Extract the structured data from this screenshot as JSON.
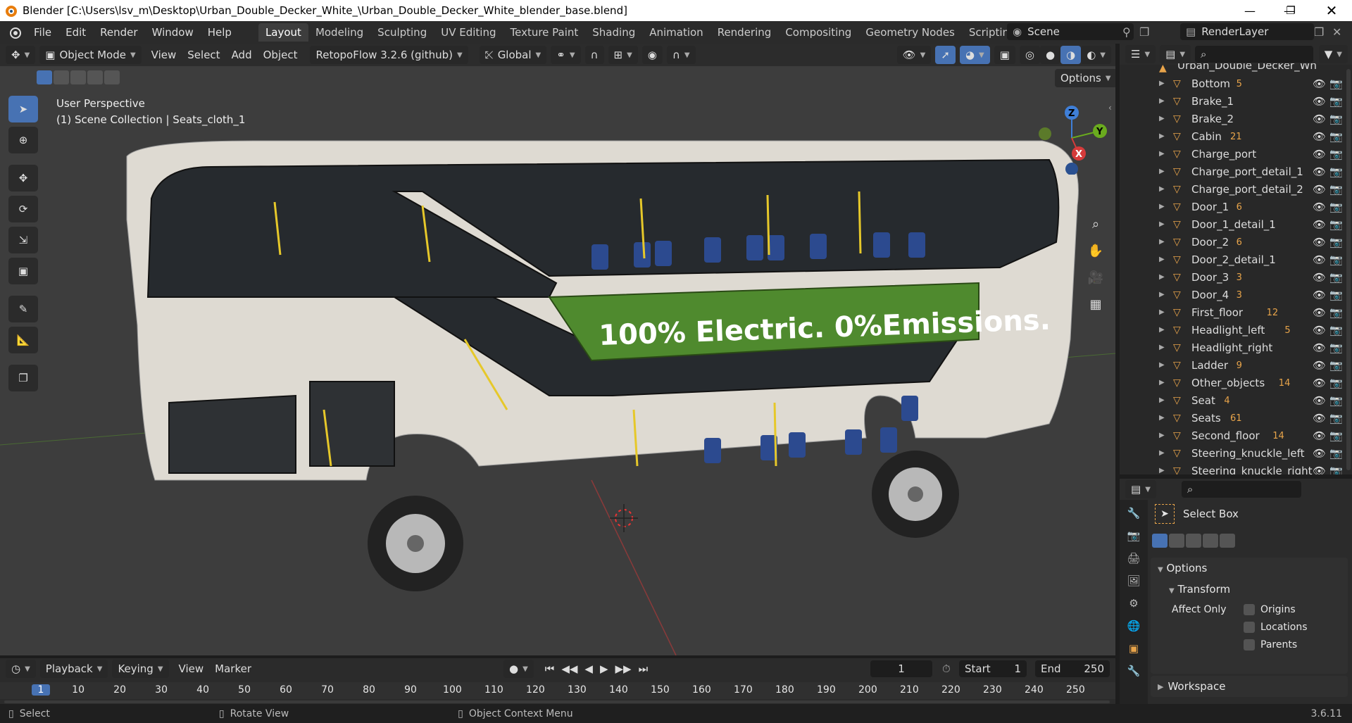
{
  "titlebar": {
    "title": "Blender [C:\\Users\\lsv_m\\Desktop\\Urban_Double_Decker_White_\\Urban_Double_Decker_White_blender_base.blend]"
  },
  "menus": [
    "File",
    "Edit",
    "Render",
    "Window",
    "Help"
  ],
  "workspaces": [
    "Layout",
    "Modeling",
    "Sculpting",
    "UV Editing",
    "Texture Paint",
    "Shading",
    "Animation",
    "Rendering",
    "Compositing",
    "Geometry Nodes",
    "Scripting"
  ],
  "scene": {
    "name": "Scene",
    "render_layer": "RenderLayer"
  },
  "viewport_header": {
    "mode": "Object Mode",
    "menus": [
      "View",
      "Select",
      "Add",
      "Object"
    ],
    "addon": "RetopoFlow 3.2.6 (github)",
    "orientation": "Global",
    "options_label": "Options"
  },
  "viewport_info": {
    "line1": "User Perspective",
    "line2": "(1) Scene Collection | Seats_cloth_1"
  },
  "bus": {
    "ad_text": "100% Electric. 0%Emissions."
  },
  "gizmo": {
    "z": "Z",
    "y": "Y",
    "x": "X"
  },
  "outliner": {
    "top_item": "Urban_Double_Decker_Wh",
    "items": [
      {
        "name": "Bottom",
        "badge": "5"
      },
      {
        "name": "Brake_1",
        "badge": ""
      },
      {
        "name": "Brake_2",
        "badge": ""
      },
      {
        "name": "Cabin",
        "badge": "21"
      },
      {
        "name": "Charge_port",
        "badge": ""
      },
      {
        "name": "Charge_port_detail_1",
        "badge": ""
      },
      {
        "name": "Charge_port_detail_2",
        "badge": ""
      },
      {
        "name": "Door_1",
        "badge": "6"
      },
      {
        "name": "Door_1_detail_1",
        "badge": ""
      },
      {
        "name": "Door_2",
        "badge": "6"
      },
      {
        "name": "Door_2_detail_1",
        "badge": ""
      },
      {
        "name": "Door_3",
        "badge": "3"
      },
      {
        "name": "Door_4",
        "badge": "3"
      },
      {
        "name": "First_floor",
        "badge": "12"
      },
      {
        "name": "Headlight_left",
        "badge": "5"
      },
      {
        "name": "Headlight_right",
        "badge": ""
      },
      {
        "name": "Ladder",
        "badge": "9"
      },
      {
        "name": "Other_objects",
        "badge": "14"
      },
      {
        "name": "Seat",
        "badge": "4"
      },
      {
        "name": "Seats",
        "badge": "61"
      },
      {
        "name": "Second_floor",
        "badge": "14"
      },
      {
        "name": "Steering_knuckle_left",
        "badge": ""
      },
      {
        "name": "Steering_knuckle_right",
        "badge": ""
      }
    ]
  },
  "properties": {
    "tool": "Select Box",
    "options": "Options",
    "transform": "Transform",
    "affect_only": "Affect Only",
    "checks": [
      "Origins",
      "Locations",
      "Parents"
    ],
    "workspace": "Workspace"
  },
  "timeline": {
    "menus": [
      "Playback",
      "Keying",
      "View",
      "Marker"
    ],
    "current": "1",
    "start_label": "Start",
    "start": "1",
    "end_label": "End",
    "end": "250",
    "ticks": [
      "1",
      "10",
      "20",
      "30",
      "40",
      "50",
      "60",
      "70",
      "80",
      "90",
      "100",
      "110",
      "120",
      "130",
      "140",
      "150",
      "160",
      "170",
      "180",
      "190",
      "200",
      "210",
      "220",
      "230",
      "240",
      "250"
    ]
  },
  "status": {
    "select": "Select",
    "rotate": "Rotate View",
    "context": "Object Context Menu",
    "version": "3.6.11"
  }
}
